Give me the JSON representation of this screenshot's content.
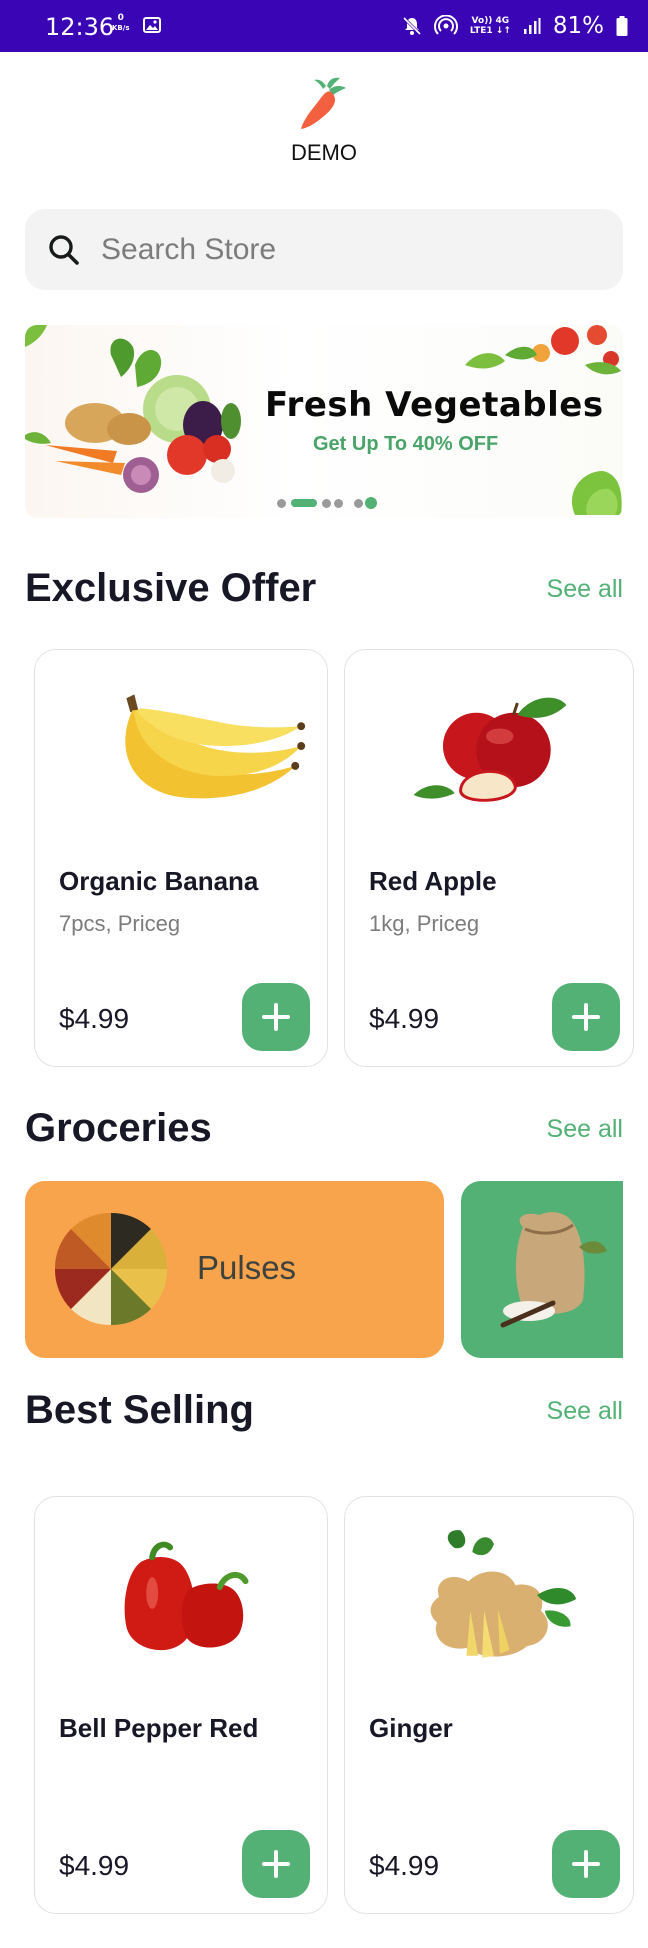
{
  "status_bar": {
    "time": "12:36",
    "speed_value": "0",
    "speed_unit": "KB/s",
    "net_top": "Vo)) 4G",
    "net_bottom": "LTE1 ↓↑",
    "battery": "81%"
  },
  "header": {
    "brand": "DEMO"
  },
  "search": {
    "placeholder": "Search Store",
    "icon": "search-icon"
  },
  "banner": {
    "title": "Fresh Vegetables",
    "subtitle": "Get Up To 40% OFF",
    "slide_count": 5,
    "active_slide": 1
  },
  "exclusive_offer": {
    "title": "Exclusive Offer",
    "see_all": "See all",
    "products": [
      {
        "name": "Organic Banana",
        "unit": "7pcs, Priceg",
        "price": "$4.99",
        "image": "banana-image"
      },
      {
        "name": "Red Apple",
        "unit": "1kg, Priceg",
        "price": "$4.99",
        "image": "apple-image"
      }
    ]
  },
  "groceries": {
    "title": "Groceries",
    "see_all": "See all",
    "categories": [
      {
        "label": "Pulses",
        "color": "#f8a44c"
      },
      {
        "label": "",
        "color": "#53b175"
      }
    ]
  },
  "best_selling": {
    "title": "Best Selling",
    "see_all": "See all",
    "products": [
      {
        "name": "Bell Pepper Red",
        "unit": "",
        "price": "$4.99",
        "image": "bell-pepper-image"
      },
      {
        "name": "Ginger",
        "unit": "",
        "price": "$4.99",
        "image": "ginger-image"
      }
    ]
  },
  "colors": {
    "accent": "#53b175",
    "status_bar": "#3a05b5",
    "pulses": "#f8a44c"
  }
}
